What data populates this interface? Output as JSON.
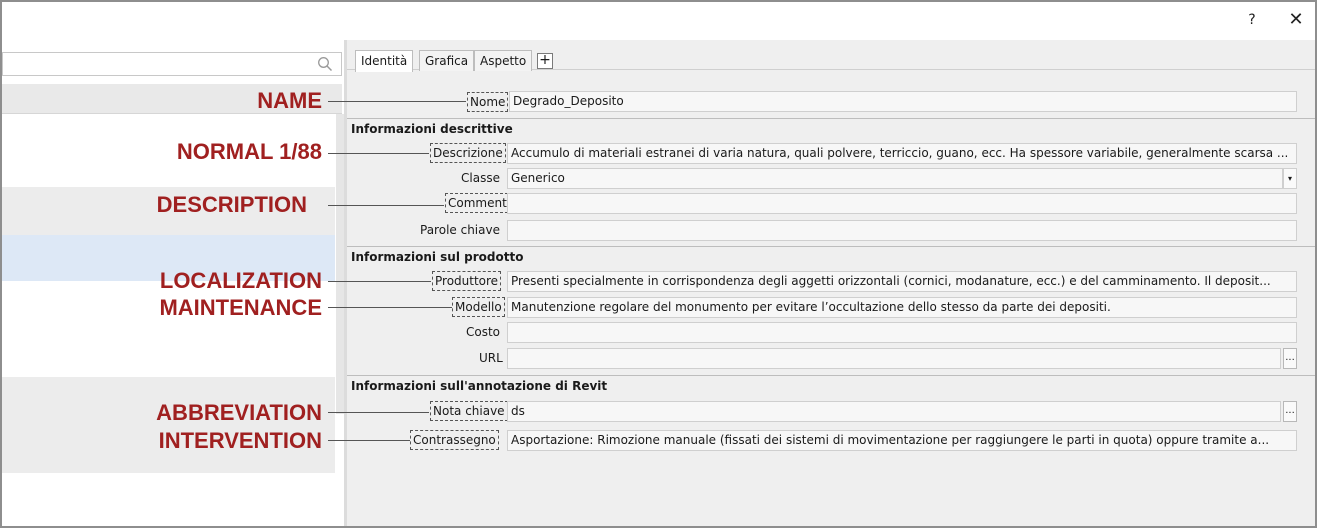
{
  "window": {
    "help_label": "?",
    "close_label": "✕"
  },
  "left": {
    "search_icon": "search-icon",
    "rows": [
      {
        "id": "row1",
        "bg": "#ffffff"
      },
      {
        "id": "row2",
        "bg": "#ececec"
      },
      {
        "id": "row3",
        "bg": "#dde8f6"
      },
      {
        "id": "row4",
        "bg": "#ffffff"
      },
      {
        "id": "row5",
        "bg": "#ececec"
      }
    ]
  },
  "tabs": [
    {
      "label": "Identità",
      "active": true
    },
    {
      "label": "Grafica",
      "active": false
    },
    {
      "label": "Aspetto",
      "active": false
    }
  ],
  "tab_add_label": "+",
  "properties": {
    "nome": {
      "label": "Nome",
      "value": "Degrado_Deposito"
    },
    "section_descrittive": "Informazioni descrittive",
    "descrizione": {
      "label": "Descrizione",
      "value": "Accumulo di materiali estranei di varia natura, quali polvere, terriccio, guano, ecc. Ha spessore variabile, generalmente scarsa ..."
    },
    "classe": {
      "label": "Classe",
      "value": "Generico"
    },
    "commenti": {
      "label": "Commenti",
      "value": ""
    },
    "parole_chiave": {
      "label": "Parole chiave",
      "value": ""
    },
    "section_prodotto": "Informazioni sul prodotto",
    "produttore": {
      "label": "Produttore",
      "value": "Presenti specialmente in corrispondenza degli aggetti orizzontali (cornici, modanature, ecc.) e del camminamento. Il deposit..."
    },
    "modello": {
      "label": "Modello",
      "value": "Manutenzione regolare del monumento per evitare l’occultazione dello stesso da parte dei depositi."
    },
    "costo": {
      "label": "Costo",
      "value": ""
    },
    "url": {
      "label": "URL",
      "value": ""
    },
    "section_revit": "Informazioni sull'annotazione di Revit",
    "nota_chiave": {
      "label": "Nota chiave",
      "value": "ds"
    },
    "contrassegno": {
      "label": "Contrassegno",
      "value": "Asportazione: Rimozione manuale (fissati dei sistemi di movimentazione per raggiungere le parti in quota) oppure tramite a..."
    }
  },
  "buttons": {
    "dropdown": "▾",
    "ellipsis": "..."
  },
  "annotations": {
    "name": "NAME",
    "normal": "NORMAL 1/88",
    "description": "DESCRIPTION",
    "localization": "LOCALIZATION",
    "maintenance": "MAINTENANCE",
    "abbreviation": "ABBREVIATION",
    "intervention": "INTERVENTION"
  },
  "colors": {
    "annotation": "#a02020",
    "selected_row": "#dde8f6"
  }
}
